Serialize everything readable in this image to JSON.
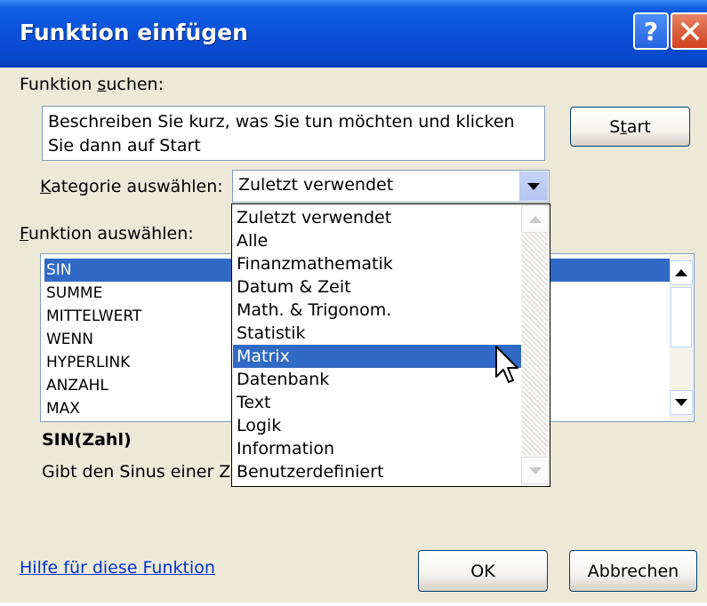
{
  "dialog": {
    "title": "Funktion einfügen",
    "help_button": "?",
    "close_button": "X",
    "search": {
      "label_before": "Funktion ",
      "label_mnemonic": "s",
      "label_after": "uchen:",
      "value": "Beschreiben Sie kurz, was Sie tun möchten und klicken Sie dann auf Start",
      "button_before": "S",
      "button_mnemonic": "t",
      "button_after": "art"
    },
    "category": {
      "label_mnemonic": "K",
      "label_after": "ategorie auswählen:",
      "selected": "Zuletzt verwendet",
      "options": [
        "Zuletzt verwendet",
        "Alle",
        "Finanzmathematik",
        "Datum & Zeit",
        "Math. & Trigonom.",
        "Statistik",
        "Matrix",
        "Datenbank",
        "Text",
        "Logik",
        "Information",
        "Benutzerdefiniert"
      ],
      "highlighted": "Matrix"
    },
    "functions": {
      "label_mnemonic": "F",
      "label_after": "unktion auswählen:",
      "items": [
        "SIN",
        "SUMME",
        "MITTELWERT",
        "WENN",
        "HYPERLINK",
        "ANZAHL",
        "MAX"
      ],
      "selected": "SIN"
    },
    "description": {
      "syntax": "SIN(Zahl)",
      "text": "Gibt den Sinus einer Za"
    },
    "help_link": "Hilfe für diese Funktion",
    "ok_button": "OK",
    "cancel_button": "Abbrechen"
  },
  "colors": {
    "titlebar": "#0a4fd6",
    "selection": "#316ac5",
    "dialog_bg": "#ece9d8",
    "link": "#0033cc"
  }
}
